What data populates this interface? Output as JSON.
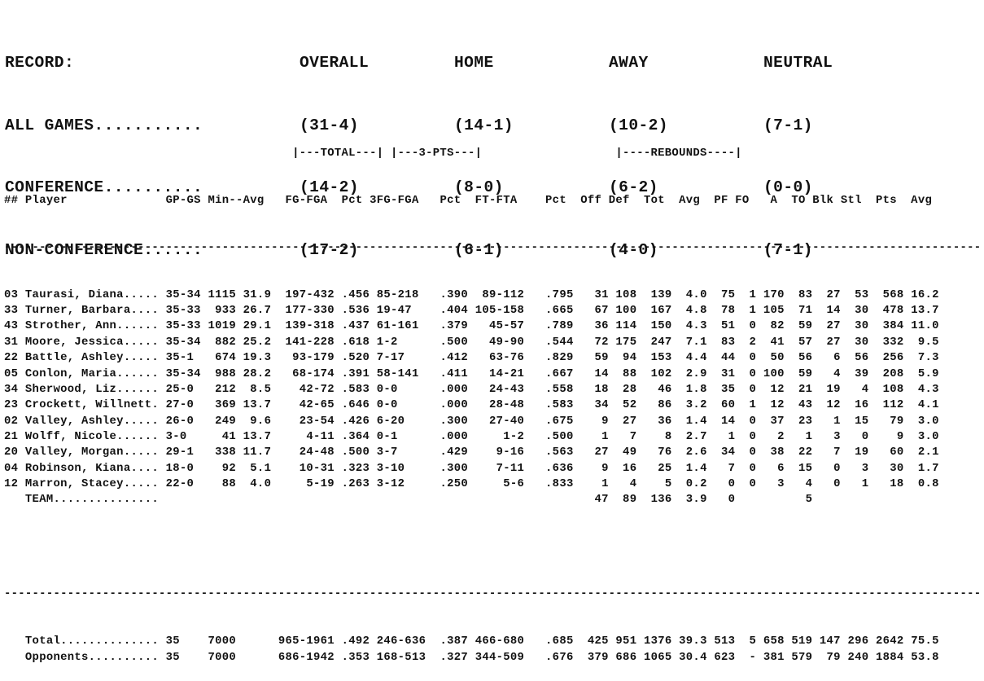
{
  "record": {
    "title": "RECORD:",
    "columns": [
      "OVERALL",
      "HOME",
      "AWAY",
      "NEUTRAL"
    ],
    "rows": [
      {
        "label": "ALL GAMES...........",
        "overall": "(31-4)",
        "home": "(14-1)",
        "away": "(10-2)",
        "neutral": "(7-1)"
      },
      {
        "label": "CONFERENCE..........",
        "overall": "(14-2)",
        "home": "(8-0)",
        "away": "(6-2)",
        "neutral": "(0-0)"
      },
      {
        "label": "NON-CONFERENCE......",
        "overall": "(17-2)",
        "home": "(6-1)",
        "away": "(4-0)",
        "neutral": "(7-1)"
      }
    ]
  },
  "stats": {
    "group_headers": {
      "total": "|---TOTAL---|",
      "three_pts": "|---3-PTS---|",
      "rebounds": "|----REBOUNDS----|"
    },
    "columns": [
      "##",
      "Player",
      "GP-GS",
      "Min",
      "Avg",
      "FG-FGA",
      "Pct",
      "3FG-FGA",
      "Pct",
      "FT-FTA",
      "Pct",
      "Off",
      "Def",
      "Tot",
      "Avg",
      "PF",
      "FO",
      "A",
      "TO",
      "Blk",
      "Stl",
      "Pts",
      "Avg"
    ],
    "players": [
      {
        "num": "03",
        "name": "Taurasi, Diana.....",
        "gpgs": "35-34",
        "min": "1115",
        "min_avg": "31.9",
        "fg": "197-432",
        "fg_pct": ".456",
        "fg3": "85-218",
        "fg3_pct": ".390",
        "ft": "89-112",
        "ft_pct": ".795",
        "off": "31",
        "def": "108",
        "tot": "139",
        "reb_avg": "4.0",
        "pf": "75",
        "fo": "1",
        "a": "170",
        "to": "83",
        "blk": "27",
        "stl": "53",
        "pts": "568",
        "pts_avg": "16.2"
      },
      {
        "num": "33",
        "name": "Turner, Barbara....",
        "gpgs": "35-33",
        "min": "933",
        "min_avg": "26.7",
        "fg": "177-330",
        "fg_pct": ".536",
        "fg3": "19-47",
        "fg3_pct": ".404",
        "ft": "105-158",
        "ft_pct": ".665",
        "off": "67",
        "def": "100",
        "tot": "167",
        "reb_avg": "4.8",
        "pf": "78",
        "fo": "1",
        "a": "105",
        "to": "71",
        "blk": "14",
        "stl": "30",
        "pts": "478",
        "pts_avg": "13.7"
      },
      {
        "num": "43",
        "name": "Strother, Ann......",
        "gpgs": "35-33",
        "min": "1019",
        "min_avg": "29.1",
        "fg": "139-318",
        "fg_pct": ".437",
        "fg3": "61-161",
        "fg3_pct": ".379",
        "ft": "45-57",
        "ft_pct": ".789",
        "off": "36",
        "def": "114",
        "tot": "150",
        "reb_avg": "4.3",
        "pf": "51",
        "fo": "0",
        "a": "82",
        "to": "59",
        "blk": "27",
        "stl": "30",
        "pts": "384",
        "pts_avg": "11.0"
      },
      {
        "num": "31",
        "name": "Moore, Jessica.....",
        "gpgs": "35-34",
        "min": "882",
        "min_avg": "25.2",
        "fg": "141-228",
        "fg_pct": ".618",
        "fg3": "1-2",
        "fg3_pct": ".500",
        "ft": "49-90",
        "ft_pct": ".544",
        "off": "72",
        "def": "175",
        "tot": "247",
        "reb_avg": "7.1",
        "pf": "83",
        "fo": "2",
        "a": "41",
        "to": "57",
        "blk": "27",
        "stl": "30",
        "pts": "332",
        "pts_avg": "9.5"
      },
      {
        "num": "22",
        "name": "Battle, Ashley.....",
        "gpgs": "35-1",
        "min": "674",
        "min_avg": "19.3",
        "fg": "93-179",
        "fg_pct": ".520",
        "fg3": "7-17",
        "fg3_pct": ".412",
        "ft": "63-76",
        "ft_pct": ".829",
        "off": "59",
        "def": "94",
        "tot": "153",
        "reb_avg": "4.4",
        "pf": "44",
        "fo": "0",
        "a": "50",
        "to": "56",
        "blk": "6",
        "stl": "56",
        "pts": "256",
        "pts_avg": "7.3"
      },
      {
        "num": "05",
        "name": "Conlon, Maria......",
        "gpgs": "35-34",
        "min": "988",
        "min_avg": "28.2",
        "fg": "68-174",
        "fg_pct": ".391",
        "fg3": "58-141",
        "fg3_pct": ".411",
        "ft": "14-21",
        "ft_pct": ".667",
        "off": "14",
        "def": "88",
        "tot": "102",
        "reb_avg": "2.9",
        "pf": "31",
        "fo": "0",
        "a": "100",
        "to": "59",
        "blk": "4",
        "stl": "39",
        "pts": "208",
        "pts_avg": "5.9"
      },
      {
        "num": "34",
        "name": "Sherwood, Liz......",
        "gpgs": "25-0",
        "min": "212",
        "min_avg": "8.5",
        "fg": "42-72",
        "fg_pct": ".583",
        "fg3": "0-0",
        "fg3_pct": ".000",
        "ft": "24-43",
        "ft_pct": ".558",
        "off": "18",
        "def": "28",
        "tot": "46",
        "reb_avg": "1.8",
        "pf": "35",
        "fo": "0",
        "a": "12",
        "to": "21",
        "blk": "19",
        "stl": "4",
        "pts": "108",
        "pts_avg": "4.3"
      },
      {
        "num": "23",
        "name": "Crockett, Willnett.",
        "gpgs": "27-0",
        "min": "369",
        "min_avg": "13.7",
        "fg": "42-65",
        "fg_pct": ".646",
        "fg3": "0-0",
        "fg3_pct": ".000",
        "ft": "28-48",
        "ft_pct": ".583",
        "off": "34",
        "def": "52",
        "tot": "86",
        "reb_avg": "3.2",
        "pf": "60",
        "fo": "1",
        "a": "12",
        "to": "43",
        "blk": "12",
        "stl": "16",
        "pts": "112",
        "pts_avg": "4.1"
      },
      {
        "num": "02",
        "name": "Valley, Ashley.....",
        "gpgs": "26-0",
        "min": "249",
        "min_avg": "9.6",
        "fg": "23-54",
        "fg_pct": ".426",
        "fg3": "6-20",
        "fg3_pct": ".300",
        "ft": "27-40",
        "ft_pct": ".675",
        "off": "9",
        "def": "27",
        "tot": "36",
        "reb_avg": "1.4",
        "pf": "14",
        "fo": "0",
        "a": "37",
        "to": "23",
        "blk": "1",
        "stl": "15",
        "pts": "79",
        "pts_avg": "3.0"
      },
      {
        "num": "21",
        "name": "Wolff, Nicole......",
        "gpgs": "3-0",
        "min": "41",
        "min_avg": "13.7",
        "fg": "4-11",
        "fg_pct": ".364",
        "fg3": "0-1",
        "fg3_pct": ".000",
        "ft": "1-2",
        "ft_pct": ".500",
        "off": "1",
        "def": "7",
        "tot": "8",
        "reb_avg": "2.7",
        "pf": "1",
        "fo": "0",
        "a": "2",
        "to": "1",
        "blk": "3",
        "stl": "0",
        "pts": "9",
        "pts_avg": "3.0"
      },
      {
        "num": "20",
        "name": "Valley, Morgan.....",
        "gpgs": "29-1",
        "min": "338",
        "min_avg": "11.7",
        "fg": "24-48",
        "fg_pct": ".500",
        "fg3": "3-7",
        "fg3_pct": ".429",
        "ft": "9-16",
        "ft_pct": ".563",
        "off": "27",
        "def": "49",
        "tot": "76",
        "reb_avg": "2.6",
        "pf": "34",
        "fo": "0",
        "a": "38",
        "to": "22",
        "blk": "7",
        "stl": "19",
        "pts": "60",
        "pts_avg": "2.1"
      },
      {
        "num": "04",
        "name": "Robinson, Kiana....",
        "gpgs": "18-0",
        "min": "92",
        "min_avg": "5.1",
        "fg": "10-31",
        "fg_pct": ".323",
        "fg3": "3-10",
        "fg3_pct": ".300",
        "ft": "7-11",
        "ft_pct": ".636",
        "off": "9",
        "def": "16",
        "tot": "25",
        "reb_avg": "1.4",
        "pf": "7",
        "fo": "0",
        "a": "6",
        "to": "15",
        "blk": "0",
        "stl": "3",
        "pts": "30",
        "pts_avg": "1.7"
      },
      {
        "num": "12",
        "name": "Marron, Stacey.....",
        "gpgs": "22-0",
        "min": "88",
        "min_avg": "4.0",
        "fg": "5-19",
        "fg_pct": ".263",
        "fg3": "3-12",
        "fg3_pct": ".250",
        "ft": "5-6",
        "ft_pct": ".833",
        "off": "1",
        "def": "4",
        "tot": "5",
        "reb_avg": "0.2",
        "pf": "0",
        "fo": "0",
        "a": "3",
        "to": "4",
        "blk": "0",
        "stl": "1",
        "pts": "18",
        "pts_avg": "0.8"
      },
      {
        "num": "",
        "name": "TEAM...............",
        "gpgs": "",
        "min": "",
        "min_avg": "",
        "fg": "",
        "fg_pct": "",
        "fg3": "",
        "fg3_pct": "",
        "ft": "",
        "ft_pct": "",
        "off": "47",
        "def": "89",
        "tot": "136",
        "reb_avg": "3.9",
        "pf": "0",
        "fo": "",
        "a": "",
        "to": "5",
        "blk": "",
        "stl": "",
        "pts": "",
        "pts_avg": ""
      }
    ],
    "totals": [
      {
        "num": "",
        "name": "Total..............",
        "gpgs": "35",
        "min": "7000",
        "min_avg": "",
        "fg": "965-1961",
        "fg_pct": ".492",
        "fg3": "246-636",
        "fg3_pct": ".387",
        "ft": "466-680",
        "ft_pct": ".685",
        "off": "425",
        "def": "951",
        "tot": "1376",
        "reb_avg": "39.3",
        "pf": "513",
        "fo": "5",
        "a": "658",
        "to": "519",
        "blk": "147",
        "stl": "296",
        "pts": "2642",
        "pts_avg": "75.5"
      },
      {
        "num": "",
        "name": "Opponents..........",
        "gpgs": "35",
        "min": "7000",
        "min_avg": "",
        "fg": "686-1942",
        "fg_pct": ".353",
        "fg3": "168-513",
        "fg3_pct": ".327",
        "ft": "344-509",
        "ft_pct": ".676",
        "off": "379",
        "def": "686",
        "tot": "1065",
        "reb_avg": "30.4",
        "pf": "623",
        "fo": "-",
        "a": "381",
        "to": "579",
        "blk": "79",
        "stl": "240",
        "pts": "1884",
        "pts_avg": "53.8"
      }
    ]
  }
}
